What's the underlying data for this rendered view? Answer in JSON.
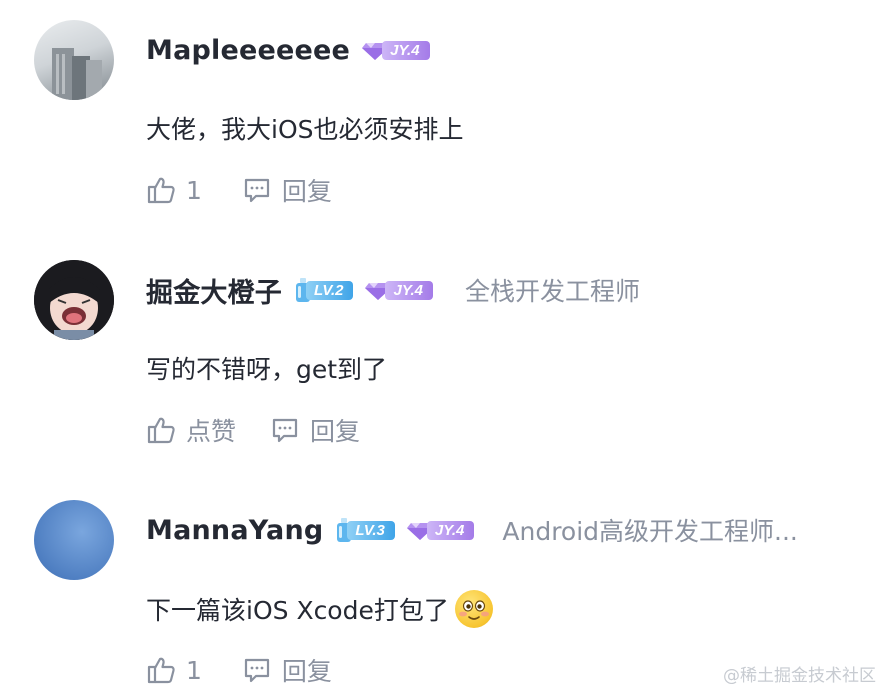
{
  "comments": [
    {
      "username": "Mapleeeeeee",
      "jy_badge": "JY.4",
      "content": "大佬，我大iOS也必须安排上",
      "like_label": "1",
      "reply_label": "回复",
      "avatar_colors": [
        "#cfd4d8",
        "#7f878d"
      ]
    },
    {
      "username": "掘金大橙子",
      "lv_badge": "LV.2",
      "jy_badge": "JY.4",
      "title": "全栈开发工程师",
      "content": "写的不错呀，get到了",
      "like_label": "点赞",
      "reply_label": "回复",
      "avatar_colors": [
        "#1b1b1f",
        "#f3d9d0"
      ]
    },
    {
      "username": "MannaYang",
      "lv_badge": "LV.3",
      "jy_badge": "JY.4",
      "title": "Android高级开发工程师...",
      "content": "下一篇该iOS Xcode打包了",
      "emoji_icon": "blushing-smile-emoji",
      "like_label": "1",
      "reply_label": "回复",
      "avatar_colors": [
        "#4f7fc2",
        "#6e9bd6"
      ]
    }
  ],
  "watermark": "@稀土掘金技术社区",
  "colors": {
    "text_primary": "#252933",
    "text_secondary": "#8a919f",
    "lv_badge": "#3fa4e8",
    "jy_badge": "#a47be8"
  }
}
